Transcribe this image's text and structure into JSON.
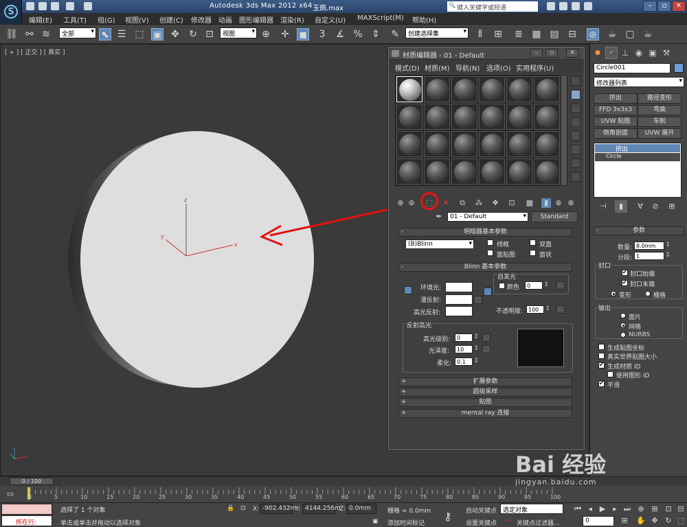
{
  "titlebar": {
    "app_title": "Autodesk 3ds Max  2012 x64",
    "file_name": "玉佩.max",
    "search_placeholder": "键入关键字或短语",
    "logo_letter": "S"
  },
  "menubar": [
    "编辑(E)",
    "工具(T)",
    "组(G)",
    "视图(V)",
    "创建(C)",
    "修改器",
    "动画",
    "图形编辑器",
    "渲染(R)",
    "自定义(U)",
    "MAXScript(M)",
    "帮助(H)"
  ],
  "toolbar": {
    "selection_filter": "全部",
    "ref_coord": "视图",
    "named_selection": "创建选择集"
  },
  "viewport": {
    "label": "[ + ] [ 正交 ] [ 真实 ]",
    "axis_x": "x",
    "axis_y": "y",
    "axis_z": "z"
  },
  "material_editor": {
    "title": "材质编辑器 - 01 - Default",
    "menu": [
      "模式(D)",
      "材质(M)",
      "导航(N)",
      "选项(O)",
      "实用程序(U)"
    ],
    "material_name": "01 - Default",
    "material_type": "Standard",
    "shader_rollout": "明暗器基本参数",
    "shader_type": "(B)Blinn",
    "wire": "线框",
    "two_sided": "双面",
    "face_map": "面贴图",
    "faceted": "面状",
    "blinn_rollout": "Blinn 基本参数",
    "self_illum": "自发光",
    "color": "颜色",
    "self_illum_value": "0",
    "ambient": "环境光:",
    "diffuse": "漫反射:",
    "specular": "高光反射:",
    "opacity_label": "不透明度:",
    "opacity_value": "100",
    "spec_group": "反射高光",
    "spec_level": "高光级别:",
    "spec_level_value": "0",
    "glossiness": "光泽度:",
    "glossiness_value": "10",
    "soften": "柔化:",
    "soften_value": "0.1",
    "rollouts": [
      "扩展参数",
      "超级采样",
      "贴图",
      "mental ray 连接"
    ]
  },
  "command_panel": {
    "object_name": "Circle001",
    "modifier_list": "修改器列表",
    "buttons": [
      "挤出",
      "路径变形",
      "FFD 3x3x3",
      "弯曲",
      "UVW 贴图",
      "车削",
      "倒角剖面",
      "UVW 展开"
    ],
    "stack": [
      "挤出",
      "Circle"
    ],
    "params_title": "参数",
    "amount_label": "数量:",
    "amount_value": "8.0mm",
    "segments_label": "分段:",
    "segments_value": "1",
    "capping": "封口",
    "cap_start": "封口始端",
    "cap_end": "封口末端",
    "morph": "变形",
    "grid": "栅格",
    "output": "输出",
    "patch": "面片",
    "mesh": "网格",
    "nurbs": "NURBS",
    "gen_map_coords": "生成贴图坐标",
    "real_world": "真实世界贴图大小",
    "gen_mat_ids": "生成材质 ID",
    "use_shape_ids": "使用图形 ID",
    "smooth": "平滑"
  },
  "timeline": {
    "frame": "0 / 100",
    "ticks": [
      "0",
      "5",
      "10",
      "15",
      "20",
      "25",
      "30",
      "35",
      "40",
      "45",
      "50",
      "55",
      "60",
      "65",
      "70",
      "75",
      "80",
      "85",
      "90",
      "95",
      "100"
    ]
  },
  "status": {
    "running": "所在行:",
    "selected": "选择了 1 个对象",
    "prompt": "单击或单击并拖动以选择对象",
    "x_label": "X:",
    "x_value": "-902.432m",
    "y_label": "Y:",
    "y_value": "4144.256m",
    "z_label": "Z:",
    "z_value": "0.0mm",
    "grid": "栅格 = 0.0mm",
    "add_time_tag": "添加时间标记",
    "auto_key": "自动关键点",
    "set_key": "设置关键点",
    "selected_object": "选定对象",
    "key_filters": "关键点过滤器...",
    "frame_value": "0"
  },
  "watermark": {
    "brand": "Bai 经验",
    "url": "jingyan.baidu.com"
  },
  "colors": {
    "accent": "#5f86b5",
    "annotation": "#e11111"
  }
}
